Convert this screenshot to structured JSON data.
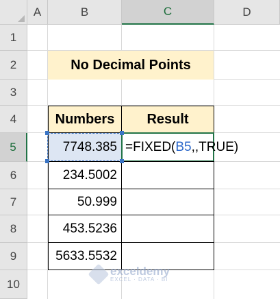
{
  "columns": [
    "A",
    "B",
    "C",
    "D"
  ],
  "rows": [
    "1",
    "2",
    "3",
    "4",
    "5",
    "6",
    "7",
    "8",
    "9",
    "10"
  ],
  "active_cell": {
    "column": "C",
    "row": "5"
  },
  "title": "No Decimal Points",
  "table": {
    "headers": [
      "Numbers",
      "Result"
    ],
    "numbers": [
      "7748.385",
      "234.5002",
      "50.999",
      "453.5236",
      "5633.5532"
    ]
  },
  "formula": {
    "prefix": "=FIXED(",
    "ref": "B5",
    "suffix": ",,TRUE)"
  },
  "watermark": {
    "name": "exceldemy",
    "tagline": "EXCEL · DATA · BI"
  },
  "colors": {
    "header_fill": "#fff2cc",
    "accent": "#217346",
    "selected_fill": "#dde6f3",
    "ref_color": "#2b67c9"
  }
}
